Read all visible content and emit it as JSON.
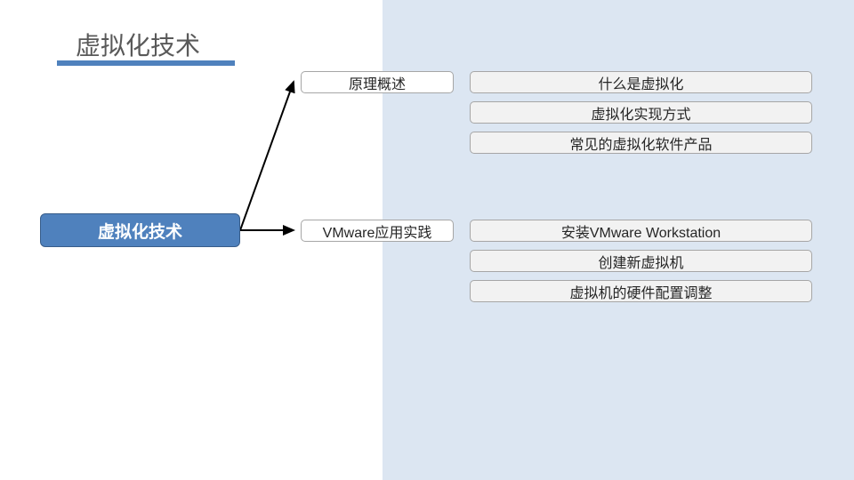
{
  "title": "虚拟化技术",
  "root": "虚拟化技术",
  "branches": [
    {
      "label": "原理概述",
      "leaves": [
        "什么是虚拟化",
        "虚拟化实现方式",
        "常见的虚拟化软件产品"
      ]
    },
    {
      "label": "VMware应用实践",
      "leaves": [
        "安装VMware Workstation",
        "创建新虚拟机",
        "虚拟机的硬件配置调整"
      ]
    }
  ],
  "colors": {
    "accent": "#4f81bd",
    "panel": "#dce6f2",
    "leaf_bg": "#f2f2f2",
    "border": "#a6a6a6"
  }
}
